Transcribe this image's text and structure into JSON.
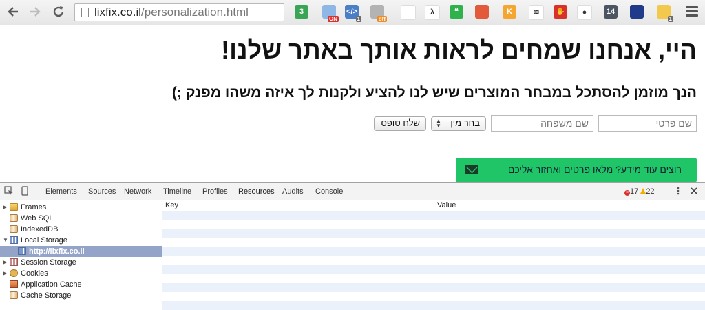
{
  "browser": {
    "url_host": "lixfix.co.il",
    "url_path": "/personalization.html",
    "extensions": [
      {
        "name": "ext-3-icon",
        "text": "3",
        "color": "#3aa655",
        "badge": ""
      },
      {
        "name": "ext-on-icon",
        "text": "",
        "color": "#8fb7e6",
        "badge": "ON"
      },
      {
        "name": "ext-code-icon",
        "text": "</>",
        "color": "#4a7fc7",
        "badge": "1"
      },
      {
        "name": "ext-cat-off-icon",
        "text": "",
        "color": "#b3b3b3",
        "badge": "off"
      },
      {
        "name": "ext-gear-red-icon",
        "text": "",
        "color": "#ffffff",
        "badge": ""
      },
      {
        "name": "ext-lambda-icon",
        "text": "λ",
        "color": "#ffffff",
        "badge": ""
      },
      {
        "name": "ext-quote-icon",
        "text": "❝",
        "color": "#2fb24c",
        "badge": ""
      },
      {
        "name": "ext-flag-icon",
        "text": "",
        "color": "#e35a3a",
        "badge": ""
      },
      {
        "name": "ext-k-icon",
        "text": "K",
        "color": "#f4a630",
        "badge": ""
      },
      {
        "name": "ext-layers-icon",
        "text": "≋",
        "color": "#ffffff",
        "badge": ""
      },
      {
        "name": "ext-stop-hand-icon",
        "text": "✋",
        "color": "#d9302c",
        "badge": ""
      },
      {
        "name": "ext-eye-icon",
        "text": "●",
        "color": "#ffffff",
        "badge": ""
      },
      {
        "name": "ext-14-icon",
        "text": "14",
        "color": "#4b5563",
        "badge": ""
      },
      {
        "name": "ext-night-icon",
        "text": "",
        "color": "#1f3b8a",
        "badge": ""
      },
      {
        "name": "ext-puzzle-icon",
        "text": "",
        "color": "#f2c94c",
        "badge": "1"
      }
    ]
  },
  "page": {
    "headline": "היי, אנחנו שמחים לראות אותך באתר שלנו!",
    "subline": "הנך מוזמן להסתכל במבחר המוצרים שיש לנו להציע ולקנות לך איזה משהו מפנק ;)",
    "form": {
      "first_name_placeholder": "שם פרטי",
      "last_name_placeholder": "שם משפחה",
      "gender_select": "בחר מין",
      "submit_label": "שלח טופס"
    },
    "promo_text": "רוצים עוד מידע? מלאו פרטים ואחזור אליכם",
    "promo_color": "#1fc567"
  },
  "devtools": {
    "tabs": [
      "Elements",
      "Sources",
      "Network",
      "Timeline",
      "Profiles",
      "Resources",
      "Audits",
      "Console"
    ],
    "active_tab": "Resources",
    "error_count": "17",
    "warning_count": "22",
    "tree": [
      {
        "label": "Frames",
        "icon": "folder",
        "twisty": "▶",
        "indent": 0
      },
      {
        "label": "Web SQL",
        "icon": "database",
        "twisty": "",
        "indent": 0
      },
      {
        "label": "IndexedDB",
        "icon": "database",
        "twisty": "",
        "indent": 0
      },
      {
        "label": "Local Storage",
        "icon": "grid",
        "twisty": "▼",
        "indent": 0
      },
      {
        "label": "http://lixfix.co.il",
        "icon": "grid",
        "twisty": "",
        "indent": 1,
        "selected": true
      },
      {
        "label": "Session Storage",
        "icon": "grid-red",
        "twisty": "▶",
        "indent": 0
      },
      {
        "label": "Cookies",
        "icon": "cookie",
        "twisty": "▶",
        "indent": 0
      },
      {
        "label": "Application Cache",
        "icon": "appcache",
        "twisty": "",
        "indent": 0
      },
      {
        "label": "Cache Storage",
        "icon": "database",
        "twisty": "",
        "indent": 0
      }
    ],
    "table": {
      "columns": [
        "Key",
        "Value"
      ]
    }
  }
}
